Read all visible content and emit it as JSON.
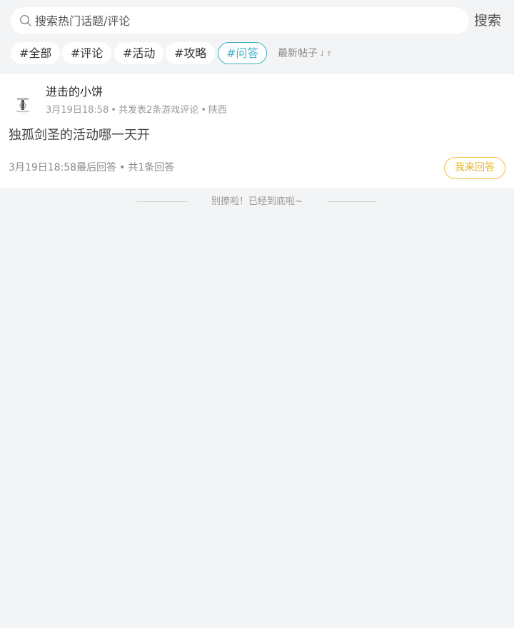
{
  "search": {
    "placeholder": "搜索热门话题/评论",
    "value": "",
    "button_label": "搜索"
  },
  "tags": [
    {
      "label": "#全部",
      "active": false
    },
    {
      "label": "#评论",
      "active": false
    },
    {
      "label": "#活动",
      "active": false
    },
    {
      "label": "#攻略",
      "active": false
    },
    {
      "label": "#问答",
      "active": true
    }
  ],
  "sort": {
    "label": "最新帖子",
    "icon": "sort-arrows-icon",
    "glyph": "⇃↾"
  },
  "colors": {
    "accent_teal": "#3fb1c6",
    "reply_yellow": "#e8b420",
    "background": "#f3f4f6"
  },
  "posts": [
    {
      "username": "进击的小饼",
      "time": "3月19日18:58",
      "post_count": "共发表2条游戏评论",
      "location": "陕西",
      "title": "独孤剑圣的活动哪一天开",
      "last_reply": "3月19日18:58最后回答",
      "reply_count": "共1条回答",
      "reply_button": "我来回答"
    }
  ],
  "separator": "•",
  "end_message": "别撩啦！已经到底啦~"
}
